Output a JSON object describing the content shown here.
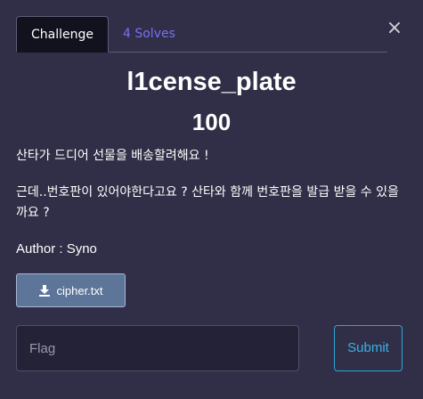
{
  "tabs": {
    "challenge_label": "Challenge",
    "solves_label": "4 Solves"
  },
  "close_glyph": "×",
  "challenge": {
    "title": "l1cense_plate",
    "points": "100",
    "description_line_1": "산타가 드디어 선물을 배송할려해요 !",
    "description_line_2": "근데..번호판이 있어야한다고요 ? 산타와 함께 번호판을 발급 받을 수 있을까요 ?",
    "author": "Author : Syno"
  },
  "file": {
    "label": "cipher.txt",
    "icon": "download-icon"
  },
  "form": {
    "flag_placeholder": "Flag",
    "flag_value": "",
    "submit_label": "Submit"
  },
  "colors": {
    "background": "#302f47",
    "active_tab": "#12121e",
    "solves_link": "#7a6ff0",
    "file_button": "#5d7598",
    "submit_accent": "#2fa4d6"
  }
}
